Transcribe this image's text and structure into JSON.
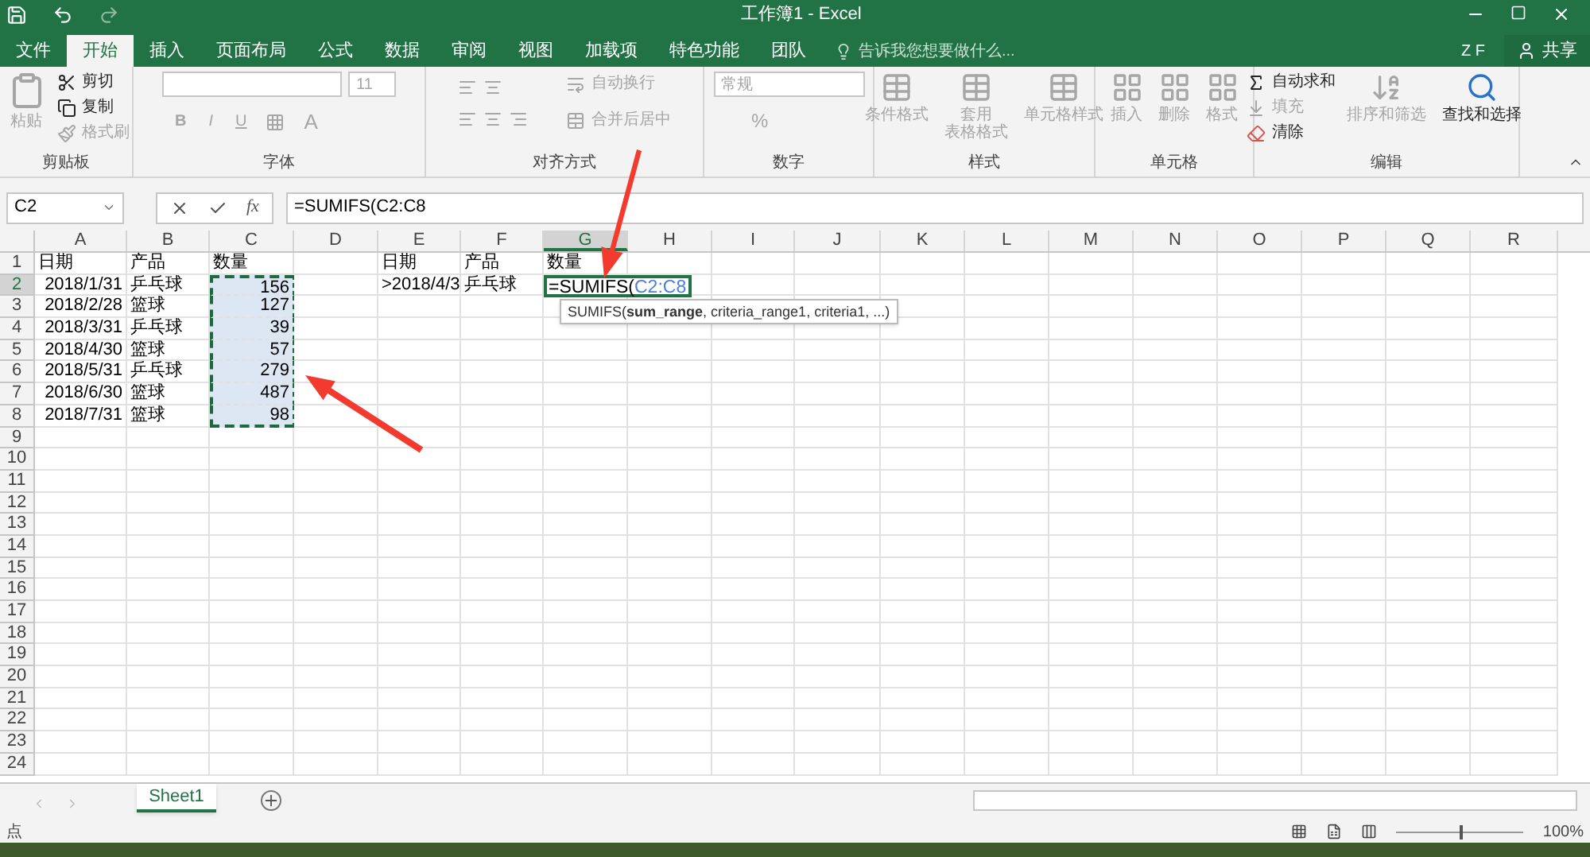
{
  "title_bar": {
    "title": "工作簿1 - Excel"
  },
  "ribbon_tabs": [
    {
      "label": "文件",
      "selected": false
    },
    {
      "label": "开始",
      "selected": true
    },
    {
      "label": "插入",
      "selected": false
    },
    {
      "label": "页面布局",
      "selected": false
    },
    {
      "label": "公式",
      "selected": false
    },
    {
      "label": "数据",
      "selected": false
    },
    {
      "label": "审阅",
      "selected": false
    },
    {
      "label": "视图",
      "selected": false
    },
    {
      "label": "加载项",
      "selected": false
    },
    {
      "label": "特色功能",
      "selected": false
    },
    {
      "label": "团队",
      "selected": false
    }
  ],
  "tell_me": {
    "placeholder": "告诉我您想要做什么..."
  },
  "user": {
    "initials": "Z F",
    "share": "共享"
  },
  "ribbon": {
    "clipboard": {
      "label": "剪贴板",
      "paste": {
        "lines": [
          "粘贴"
        ],
        "disabled": true
      },
      "items": [
        {
          "label": "剪切",
          "disabled": false
        },
        {
          "label": "复制",
          "disabled": false
        },
        {
          "label": "格式刷",
          "disabled": true
        }
      ]
    },
    "font": {
      "label": "字体",
      "size": "11",
      "bold": "B",
      "italic": "I",
      "underline": "U",
      "font_color": "A"
    },
    "alignment": {
      "label": "对齐方式",
      "items": [
        {
          "label": "自动换行",
          "disabled": true
        },
        {
          "label": "合并后居中",
          "disabled": true
        }
      ]
    },
    "number": {
      "label": "数字",
      "format": "常规",
      "percent": "%"
    },
    "styles": {
      "label": "样式",
      "items": [
        {
          "lines": [
            "条件格式"
          ],
          "disabled": true
        },
        {
          "lines": [
            "套用",
            "表格格式"
          ],
          "disabled": true
        },
        {
          "lines": [
            "单元格样式"
          ],
          "disabled": true
        }
      ]
    },
    "cells": {
      "label": "单元格",
      "items": [
        {
          "lines": [
            "插入"
          ],
          "disabled": true
        },
        {
          "lines": [
            "删除"
          ],
          "disabled": true
        },
        {
          "lines": [
            "格式"
          ],
          "disabled": true
        }
      ]
    },
    "editing": {
      "label": "编辑",
      "items": [
        {
          "label": "自动求和",
          "disabled": false
        },
        {
          "label": "填充",
          "disabled": true
        },
        {
          "label": "清除",
          "disabled": false
        }
      ],
      "sort": {
        "lines": [
          "排序和筛选"
        ],
        "disabled": true
      },
      "find": {
        "lines": [
          "查找和选择"
        ],
        "disabled": false
      }
    }
  },
  "formula_bar": {
    "name_box": "C2",
    "function_label": "fx",
    "formula": "=SUMIFS(C2:C8"
  },
  "columns": [
    {
      "label": "A",
      "selected": false
    },
    {
      "label": "B",
      "selected": false
    },
    {
      "label": "C",
      "selected": false
    },
    {
      "label": "D",
      "selected": false
    },
    {
      "label": "E",
      "selected": false
    },
    {
      "label": "F",
      "selected": false
    },
    {
      "label": "G",
      "selected": true
    },
    {
      "label": "H",
      "selected": false
    },
    {
      "label": "I",
      "selected": false
    },
    {
      "label": "J",
      "selected": false
    },
    {
      "label": "K",
      "selected": false
    },
    {
      "label": "L",
      "selected": false
    },
    {
      "label": "M",
      "selected": false
    },
    {
      "label": "N",
      "selected": false
    },
    {
      "label": "O",
      "selected": false
    },
    {
      "label": "P",
      "selected": false
    },
    {
      "label": "Q",
      "selected": false
    },
    {
      "label": "R",
      "selected": false
    }
  ],
  "rows": [
    {
      "number": "1",
      "selected": false,
      "cells": {
        "A": {
          "text": "日期"
        },
        "B": {
          "text": "产品"
        },
        "C": {
          "text": "数量"
        },
        "E": {
          "text": "日期"
        },
        "F": {
          "text": "产品"
        },
        "G": {
          "text": "数量"
        }
      }
    },
    {
      "number": "2",
      "selected": true,
      "cells": {
        "A": {
          "text": "2018/1/31",
          "kind": "number"
        },
        "B": {
          "text": "乒乓球"
        },
        "C": {
          "text": "156",
          "kind": "number",
          "highlighted": true
        },
        "E": {
          "text": ">2018/4/3"
        },
        "F": {
          "text": "乒乓球"
        },
        "G": {
          "kind": "editing",
          "text": "=SUMIFS(",
          "reference": "C2:C8",
          "active": true,
          "tooltip": "SUMIFS(**sum_range**, criteria_range1, criteria1, ...)"
        }
      }
    },
    {
      "number": "3",
      "selected": false,
      "cells": {
        "A": {
          "text": "2018/2/28",
          "kind": "number"
        },
        "B": {
          "text": "篮球"
        },
        "C": {
          "text": "127",
          "kind": "number",
          "highlighted": true
        }
      }
    },
    {
      "number": "4",
      "selected": false,
      "cells": {
        "A": {
          "text": "2018/3/31",
          "kind": "number"
        },
        "B": {
          "text": "乒乓球"
        },
        "C": {
          "text": "39",
          "kind": "number",
          "highlighted": true
        }
      }
    },
    {
      "number": "5",
      "selected": false,
      "cells": {
        "A": {
          "text": "2018/4/30",
          "kind": "number"
        },
        "B": {
          "text": "篮球"
        },
        "C": {
          "text": "57",
          "kind": "number",
          "highlighted": true
        }
      }
    },
    {
      "number": "6",
      "selected": false,
      "cells": {
        "A": {
          "text": "2018/5/31",
          "kind": "number"
        },
        "B": {
          "text": "乒乓球"
        },
        "C": {
          "text": "279",
          "kind": "number",
          "highlighted": true
        }
      }
    },
    {
      "number": "7",
      "selected": false,
      "cells": {
        "A": {
          "text": "2018/6/30",
          "kind": "number"
        },
        "B": {
          "text": "篮球"
        },
        "C": {
          "text": "487",
          "kind": "number",
          "highlighted": true
        }
      }
    },
    {
      "number": "8",
      "selected": false,
      "cells": {
        "A": {
          "text": "2018/7/31",
          "kind": "number"
        },
        "B": {
          "text": "篮球"
        },
        "C": {
          "text": "98",
          "kind": "number",
          "highlighted": true
        }
      }
    },
    {
      "number": "9",
      "selected": false,
      "cells": {}
    },
    {
      "number": "10",
      "selected": false,
      "cells": {}
    },
    {
      "number": "11",
      "selected": false,
      "cells": {}
    },
    {
      "number": "12",
      "selected": false,
      "cells": {}
    },
    {
      "number": "13",
      "selected": false,
      "cells": {}
    },
    {
      "number": "14",
      "selected": false,
      "cells": {}
    },
    {
      "number": "15",
      "selected": false,
      "cells": {}
    },
    {
      "number": "16",
      "selected": false,
      "cells": {}
    },
    {
      "number": "17",
      "selected": false,
      "cells": {}
    },
    {
      "number": "18",
      "selected": false,
      "cells": {}
    },
    {
      "number": "19",
      "selected": false,
      "cells": {}
    },
    {
      "number": "20",
      "selected": false,
      "cells": {}
    },
    {
      "number": "21",
      "selected": false,
      "cells": {}
    },
    {
      "number": "22",
      "selected": false,
      "cells": {}
    },
    {
      "number": "23",
      "selected": false,
      "cells": {}
    },
    {
      "number": "24",
      "selected": false,
      "cells": {}
    }
  ],
  "sheet_tabs": [
    {
      "label": "Sheet1",
      "selected": true
    }
  ],
  "status_bar": {
    "mode": "点",
    "zoom": {
      "level": 0.5,
      "reading": "100%"
    }
  }
}
